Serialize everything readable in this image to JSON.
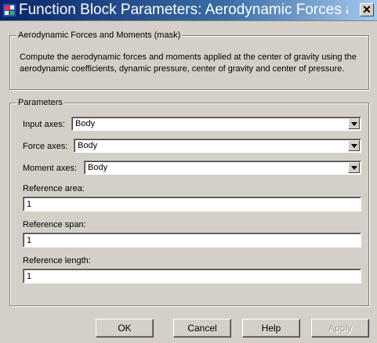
{
  "window": {
    "title": "Function Block Parameters: Aerodynamic Forces and Moments"
  },
  "mask": {
    "group_label": "Aerodynamic Forces and Moments (mask)",
    "description": "Compute the aerodynamic forces and moments applied at the center of gravity using the aerodynamic coefficients, dynamic pressure, center of gravity and center of pressure."
  },
  "parameters": {
    "group_label": "Parameters",
    "input_axes": {
      "label": "Input axes:",
      "value": "Body"
    },
    "force_axes": {
      "label": "Force axes:",
      "value": "Body"
    },
    "moment_axes": {
      "label": "Moment axes:",
      "value": "Body"
    },
    "reference_area": {
      "label": "Reference area:",
      "value": "1"
    },
    "reference_span": {
      "label": "Reference span:",
      "value": "1"
    },
    "reference_length": {
      "label": "Reference length:",
      "value": "1"
    }
  },
  "buttons": {
    "ok": "OK",
    "cancel": "Cancel",
    "help": "Help",
    "apply": "Apply"
  }
}
